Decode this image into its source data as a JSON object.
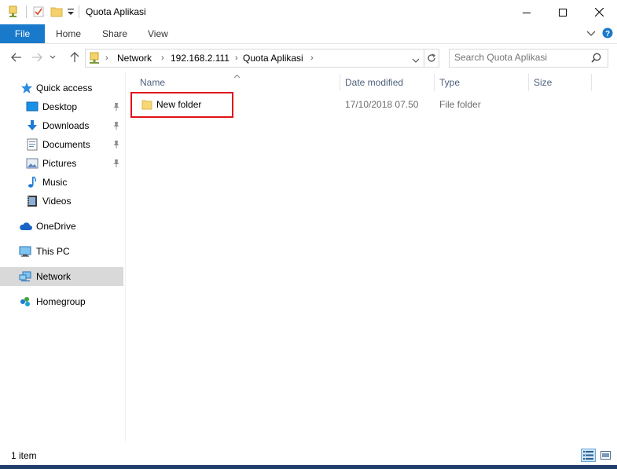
{
  "window": {
    "title": "Quota Aplikasi"
  },
  "ribbon": {
    "tabs": [
      "File",
      "Home",
      "Share",
      "View"
    ]
  },
  "address": {
    "breadcrumbs": [
      "Network",
      "192.168.2.111",
      "Quota Aplikasi"
    ]
  },
  "search": {
    "placeholder": "Search Quota Aplikasi"
  },
  "nav": {
    "items": [
      {
        "label": "Quick access",
        "icon": "star-icon",
        "pinned": false
      },
      {
        "label": "Desktop",
        "icon": "desktop-icon",
        "pinned": true
      },
      {
        "label": "Downloads",
        "icon": "download-arrow-icon",
        "pinned": true
      },
      {
        "label": "Documents",
        "icon": "documents-icon",
        "pinned": true
      },
      {
        "label": "Pictures",
        "icon": "pictures-icon",
        "pinned": true
      },
      {
        "label": "Music",
        "icon": "music-note-icon",
        "pinned": false
      },
      {
        "label": "Videos",
        "icon": "videos-icon",
        "pinned": false
      },
      {
        "label": "OneDrive",
        "icon": "cloud-icon",
        "pinned": false
      },
      {
        "label": "This PC",
        "icon": "computer-icon",
        "pinned": false
      },
      {
        "label": "Network",
        "icon": "network-icon",
        "pinned": false,
        "selected": true
      },
      {
        "label": "Homegroup",
        "icon": "homegroup-icon",
        "pinned": false
      }
    ]
  },
  "columns": [
    "Name",
    "Date modified",
    "Type",
    "Size"
  ],
  "files": [
    {
      "name": "New folder",
      "date_modified": "17/10/2018 07.50",
      "type": "File folder",
      "size": "",
      "highlighted": true
    }
  ],
  "status": {
    "item_count": "1 item"
  },
  "colors": {
    "accent": "#1979ca",
    "highlight_border": "#e0121a",
    "selected_nav": "#d9d9d9",
    "header_text": "#4c607a"
  }
}
